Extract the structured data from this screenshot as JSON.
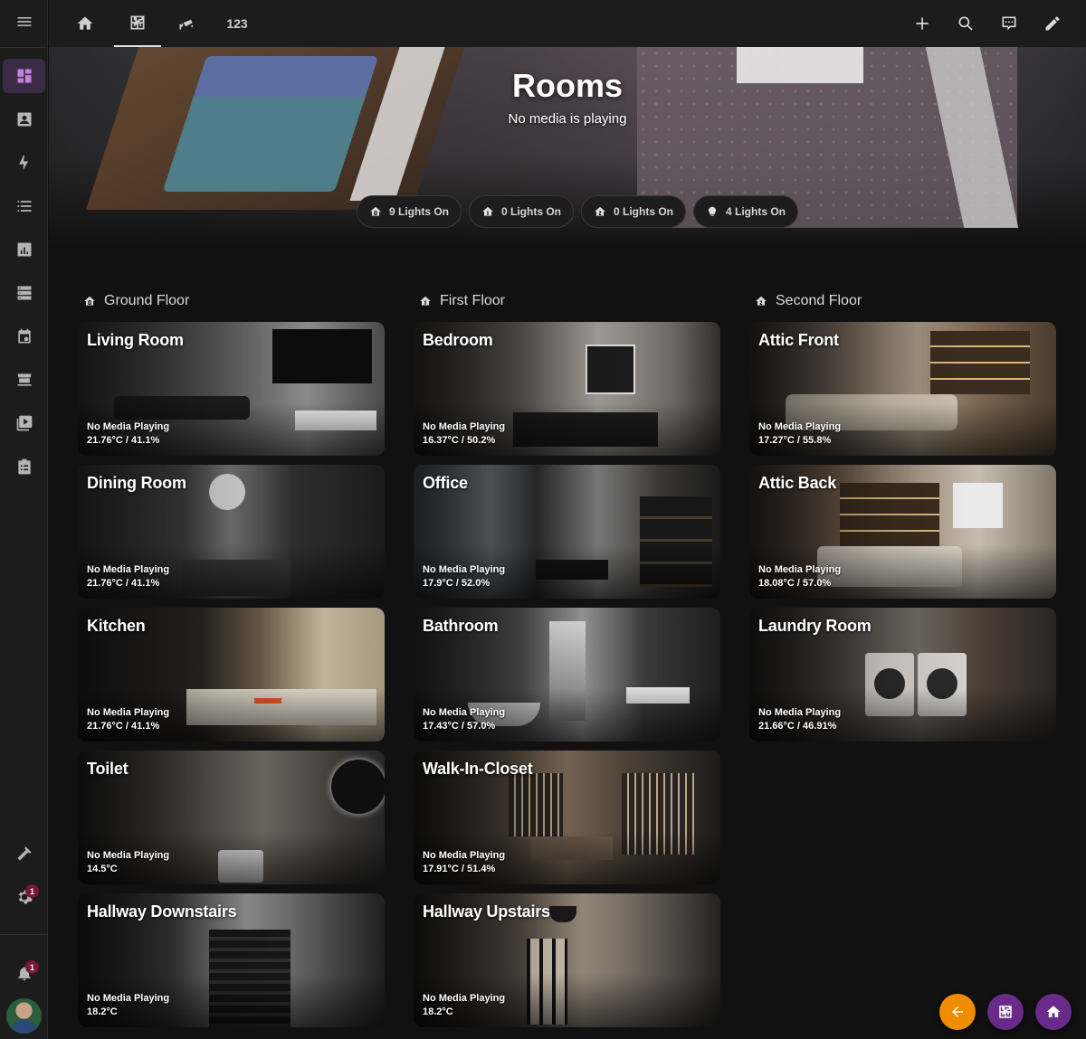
{
  "topbar": {
    "tabs": [
      {
        "icon": "home-icon"
      },
      {
        "icon": "floorplan-icon",
        "active": true
      },
      {
        "icon": "cctv-icon"
      },
      {
        "label": "123"
      }
    ],
    "tools": [
      "add-icon",
      "search-icon",
      "assist-icon",
      "edit-icon"
    ]
  },
  "sidebar": {
    "items": [
      "menu-icon",
      "dashboard-icon",
      "account-box-icon",
      "energy-icon",
      "logbook-icon",
      "history-icon",
      "server-icon",
      "calendar-icon",
      "hacs-icon",
      "media-icon",
      "todo-icon",
      "developer-tools-icon",
      "settings-icon",
      "notifications-icon"
    ],
    "settings_badge": "1",
    "notifications_badge": "1"
  },
  "hero": {
    "title": "Rooms",
    "subtitle": "No media is playing",
    "chips": [
      {
        "label": "9 Lights On",
        "icon": "home-floor-0-icon"
      },
      {
        "label": "0 Lights On",
        "icon": "home-floor-1-icon"
      },
      {
        "label": "0 Lights On",
        "icon": "home-floor-2-icon"
      },
      {
        "label": "4 Lights On",
        "icon": "outdoor-lamp-icon"
      }
    ]
  },
  "floors": [
    {
      "name": "Ground Floor",
      "rooms": [
        {
          "name": "Living Room",
          "media": "No Media Playing",
          "climate": "21.76°C / 41.1%"
        },
        {
          "name": "Dining Room",
          "media": "No Media Playing",
          "climate": "21.76°C / 41.1%"
        },
        {
          "name": "Kitchen",
          "media": "No Media Playing",
          "climate": "21.76°C / 41.1%"
        },
        {
          "name": "Toilet",
          "media": "No Media Playing",
          "climate": "14.5°C"
        },
        {
          "name": "Hallway Downstairs",
          "media": "No Media Playing",
          "climate": "18.2°C"
        }
      ]
    },
    {
      "name": "First Floor",
      "rooms": [
        {
          "name": "Bedroom",
          "media": "No Media Playing",
          "climate": "16.37°C / 50.2%"
        },
        {
          "name": "Office",
          "media": "No Media Playing",
          "climate": "17.9°C / 52.0%"
        },
        {
          "name": "Bathroom",
          "media": "No Media Playing",
          "climate": "17.43°C / 57.0%"
        },
        {
          "name": "Walk-In-Closet",
          "media": "No Media Playing",
          "climate": "17.91°C / 51.4%"
        },
        {
          "name": "Hallway Upstairs",
          "media": "No Media Playing",
          "climate": "18.2°C"
        }
      ]
    },
    {
      "name": "Second Floor",
      "rooms": [
        {
          "name": "Attic Front",
          "media": "No Media Playing",
          "climate": "17.27°C / 55.8%"
        },
        {
          "name": "Attic Back",
          "media": "No Media Playing",
          "climate": "18.08°C / 57.0%"
        },
        {
          "name": "Laundry Room",
          "media": "No Media Playing",
          "climate": "21.66°C / 46.91%"
        }
      ]
    }
  ],
  "fabs": [
    {
      "icon": "back-arrow-icon",
      "color": "#f08c00"
    },
    {
      "icon": "floorplan-icon",
      "color": "#6a2a8a"
    },
    {
      "icon": "home-icon",
      "color": "#6a2a8a"
    }
  ],
  "colors": {
    "background": "#111111",
    "sidebar": "#1c1c1c",
    "accent": "#c583e0",
    "badge": "#7a1636"
  }
}
